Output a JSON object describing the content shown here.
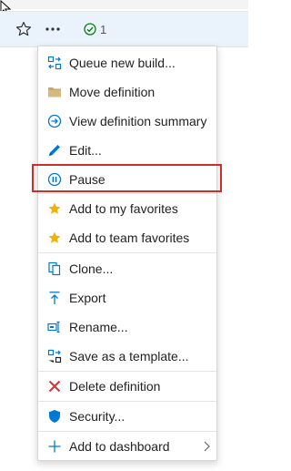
{
  "status": {
    "count": "1",
    "color": "#107c10"
  },
  "toolbar": {
    "favorite_icon": "star-outline-icon",
    "more_icon": "more-horizontal-icon"
  },
  "menu": {
    "items": [
      {
        "label": "Queue new build...",
        "icon": "queue-build-icon"
      },
      {
        "label": "Move definition",
        "icon": "folder-icon"
      },
      {
        "label": "View definition summary",
        "icon": "arrow-circle-icon"
      },
      {
        "label": "Edit...",
        "icon": "pencil-icon"
      },
      {
        "label": "Pause",
        "icon": "pause-circle-icon"
      },
      {
        "label": "Add to my favorites",
        "icon": "star-icon"
      },
      {
        "label": "Add to team favorites",
        "icon": "star-icon"
      },
      {
        "label": "Clone...",
        "icon": "copy-icon"
      },
      {
        "label": "Export",
        "icon": "export-icon"
      },
      {
        "label": "Rename...",
        "icon": "rename-icon"
      },
      {
        "label": "Save as a template...",
        "icon": "template-icon"
      },
      {
        "label": "Delete definition",
        "icon": "delete-x-icon"
      },
      {
        "label": "Security...",
        "icon": "shield-icon"
      },
      {
        "label": "Add to dashboard",
        "icon": "plus-icon"
      }
    ]
  },
  "colors": {
    "accent_blue": "#0078d4",
    "favorite_gold": "#f2b100",
    "delete_red": "#d13438",
    "folder_tan": "#c8a86b",
    "highlight_red": "#c9302c"
  }
}
